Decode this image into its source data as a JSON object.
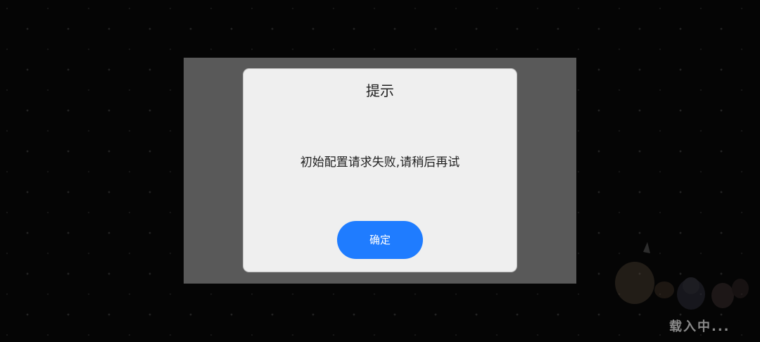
{
  "dialog": {
    "title": "提示",
    "message": "初始配置请求失败,请稍后再试",
    "confirm_label": "确定"
  },
  "loading": {
    "text": "载入中..."
  },
  "colors": {
    "background": "#050505",
    "overlay": "#595959",
    "dialog_bg": "#efefef",
    "button": "#1f7cff",
    "button_text": "#ffffff"
  },
  "icons": {
    "mascot": "game-mascot-characters-icon"
  }
}
